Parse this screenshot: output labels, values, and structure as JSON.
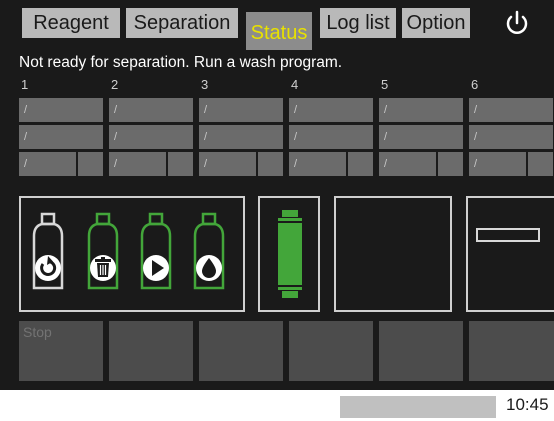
{
  "tabs": [
    {
      "label": "Reagent"
    },
    {
      "label": "Separation"
    },
    {
      "label": "Status",
      "active": true
    },
    {
      "label": "Log list"
    },
    {
      "label": "Option"
    }
  ],
  "power_icon": "power-icon",
  "message": "Not ready for separation. Run a wash program.",
  "channels": [
    {
      "number": "1",
      "rows": [
        "/",
        "/",
        "/"
      ]
    },
    {
      "number": "2",
      "rows": [
        "/",
        "/",
        "/"
      ]
    },
    {
      "number": "3",
      "rows": [
        "/",
        "/",
        "/"
      ]
    },
    {
      "number": "4",
      "rows": [
        "/",
        "/",
        "/"
      ]
    },
    {
      "number": "5",
      "rows": [
        "/",
        "/",
        "/"
      ]
    },
    {
      "number": "6",
      "rows": [
        "/",
        "/",
        "/"
      ]
    }
  ],
  "bottles": [
    {
      "icon": "refresh-icon",
      "state": "inactive"
    },
    {
      "icon": "trash-icon",
      "state": "active"
    },
    {
      "icon": "play-icon",
      "state": "active"
    },
    {
      "icon": "drop-icon",
      "state": "active"
    }
  ],
  "colors": {
    "active_green": "#43a63a",
    "inactive_gray": "#d8d8d8",
    "tab_highlight": "#e8e100"
  },
  "buttons": [
    "Stop",
    "",
    "",
    "",
    "",
    ""
  ],
  "status_bar": {
    "time": "10:45"
  }
}
